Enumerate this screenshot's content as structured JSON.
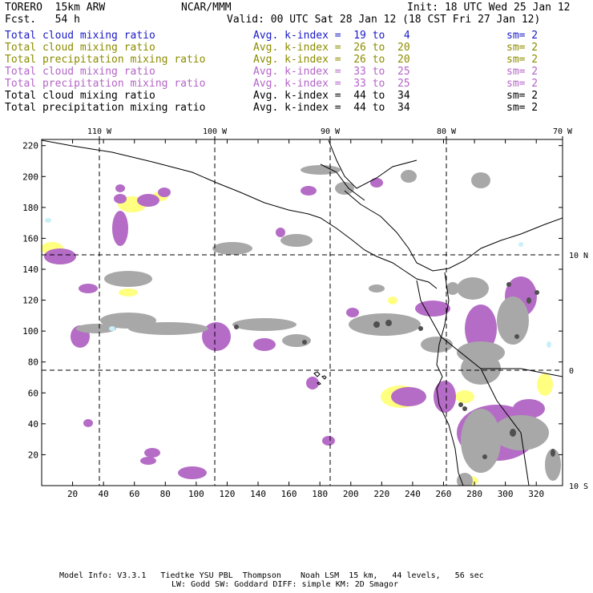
{
  "header": {
    "model": "TORERO  15km ARW",
    "org": "NCAR/MMM",
    "init": "Init: 18 UTC Wed 25 Jan 12",
    "fcst": "Fcst.   54 h",
    "valid": "Valid: 00 UTC Sat 28 Jan 12 (18 CST Fri 27 Jan 12)"
  },
  "legend": [
    {
      "field": "Total cloud mixing ratio",
      "kindex": "Avg. k-index =  19 to   4",
      "sm": "sm= 2",
      "color": "#1a1ac8"
    },
    {
      "field": "Total cloud mixing ratio",
      "kindex": "Avg. k-index =  26 to  20",
      "sm": "sm= 2",
      "color": "#8c8c00"
    },
    {
      "field": "Total precipitation mixing ratio",
      "kindex": "Avg. k-index =  26 to  20",
      "sm": "sm= 2",
      "color": "#8c8c00"
    },
    {
      "field": "Total cloud mixing ratio",
      "kindex": "Avg. k-index =  33 to  25",
      "sm": "sm= 2",
      "color": "#b464c8"
    },
    {
      "field": "Total precipitation mixing ratio",
      "kindex": "Avg. k-index =  33 to  25",
      "sm": "sm= 2",
      "color": "#b464c8"
    },
    {
      "field": "Total cloud mixing ratio",
      "kindex": "Avg. k-index =  44 to  34",
      "sm": "sm= 2",
      "color": "#000000"
    },
    {
      "field": "Total precipitation mixing ratio",
      "kindex": "Avg. k-index =  44 to  34",
      "sm": "sm= 2",
      "color": "#000000"
    }
  ],
  "map": {
    "x_ticks": [
      "20",
      "40",
      "60",
      "80",
      "100",
      "120",
      "140",
      "160",
      "180",
      "200",
      "220",
      "240",
      "260",
      "280",
      "300",
      "320"
    ],
    "y_ticks": [
      "20",
      "40",
      "60",
      "80",
      "100",
      "120",
      "140",
      "160",
      "180",
      "200",
      "220"
    ],
    "lon_labels": [
      "110 W",
      "100 W",
      "90 W",
      "80 W",
      "70 W"
    ],
    "lat_labels": [
      "10 N",
      "0",
      "10 S"
    ],
    "colors": {
      "gray": "#a8a8a8",
      "dark": "#505050",
      "purple": "#b56cc6",
      "yellow": "#ffff80",
      "cyan": "#c8f0f8"
    }
  },
  "footer": {
    "line1": "Model Info: V3.3.1   Tiedtke YSU PBL  Thompson    Noah LSM  15 km,   44 levels,   56 sec",
    "line2": "LW: Godd SW: Goddard DIFF: simple KM: 2D Smagor"
  }
}
